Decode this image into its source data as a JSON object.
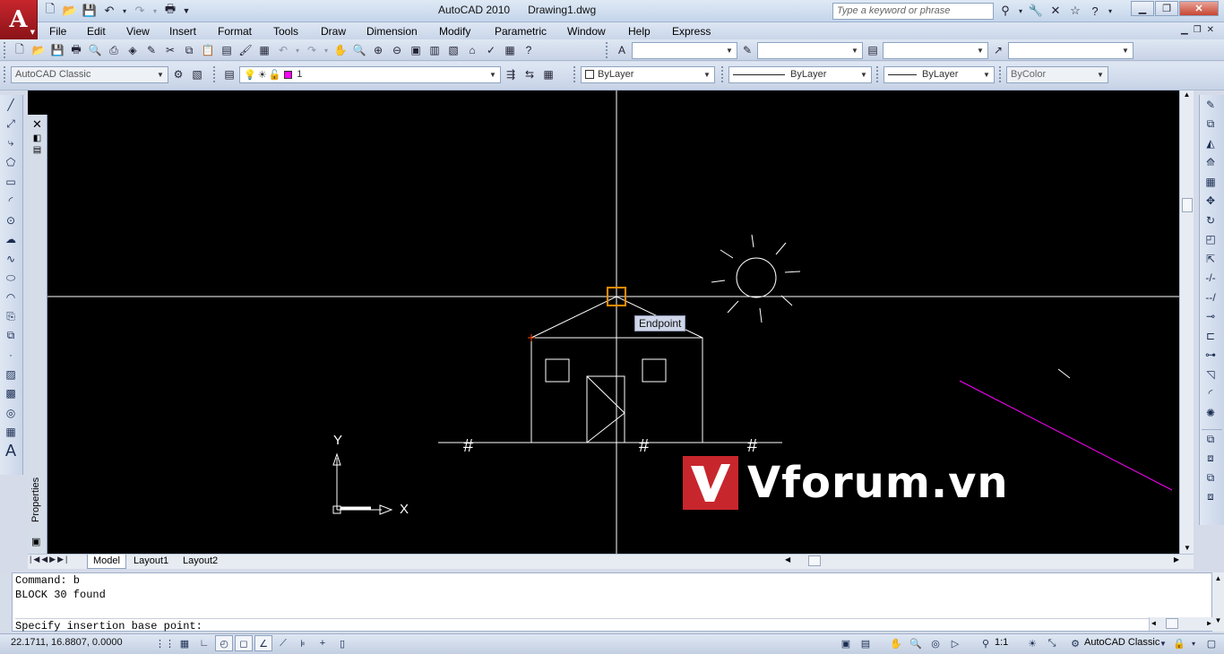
{
  "app": {
    "title": "AutoCAD 2010",
    "document": "Drawing1.dwg",
    "logo_letter": "A"
  },
  "search": {
    "placeholder": "Type a keyword or phrase"
  },
  "menu": [
    "File",
    "Edit",
    "View",
    "Insert",
    "Format",
    "Tools",
    "Draw",
    "Dimension",
    "Modify",
    "Parametric",
    "Window",
    "Help",
    "Express"
  ],
  "workspace": {
    "value": "AutoCAD Classic"
  },
  "layer": {
    "value": "1"
  },
  "properties": {
    "color": "ByLayer",
    "linetype": "ByLayer",
    "lineweight": "ByLayer",
    "plotstyle": "ByColor"
  },
  "palette": {
    "title": "Properties"
  },
  "canvas": {
    "tooltip": "Endpoint",
    "ucs_x": "X",
    "ucs_y": "Y",
    "watermark": "Vforum.vn",
    "hash": "#"
  },
  "layout_tabs": [
    "Model",
    "Layout1",
    "Layout2"
  ],
  "command": {
    "lines": [
      "Command: b",
      "BLOCK 30 found"
    ],
    "prompt": "Specify insertion base point:"
  },
  "status": {
    "coords": "22.1711, 16.8807, 0.0000",
    "scale": "1:1",
    "workspace": "AutoCAD Classic"
  },
  "colors": {
    "accent": "#c8262d",
    "canvas": "#000000",
    "magenta": "#ff00ff",
    "osnap": "#ff8c00"
  }
}
